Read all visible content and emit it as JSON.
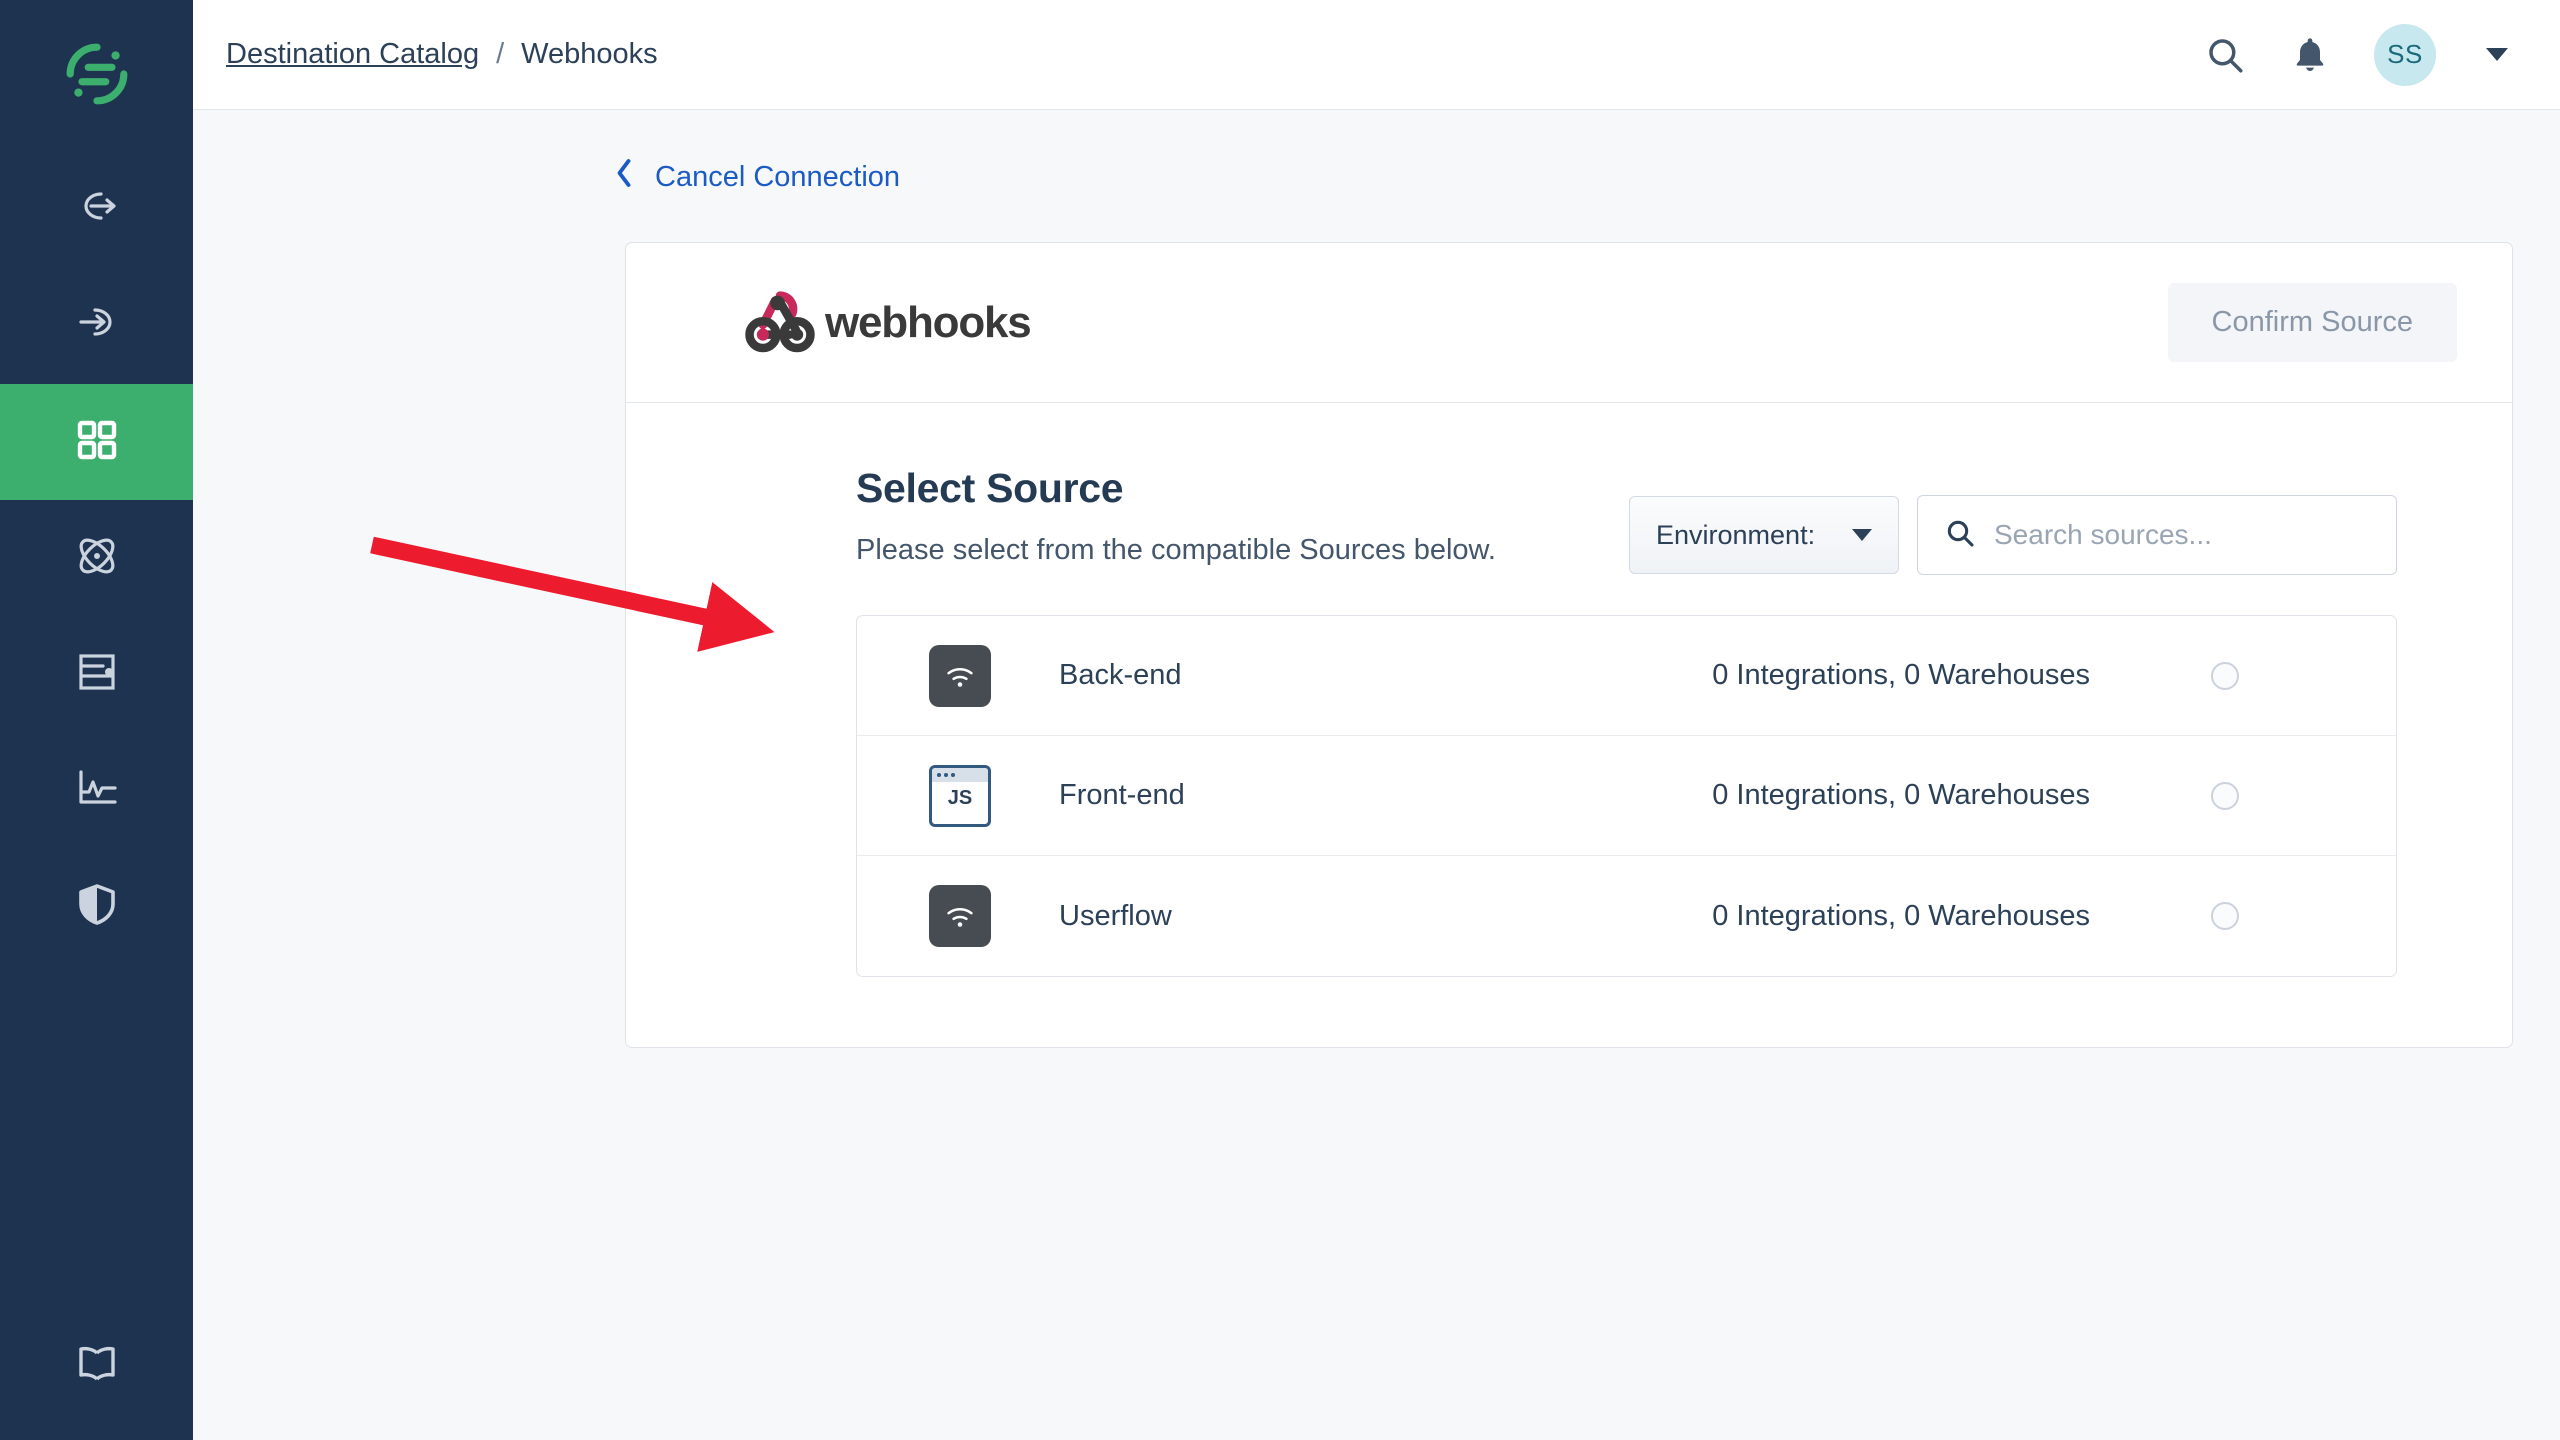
{
  "sidebar": {
    "logo_label": "segment-logo",
    "items": [
      {
        "name": "sources",
        "icon": "arrow-out-circle-icon",
        "active": false
      },
      {
        "name": "destinations",
        "icon": "arrow-in-circle-icon",
        "active": false
      },
      {
        "name": "catalog",
        "icon": "grid-squares-icon",
        "active": true
      },
      {
        "name": "connections",
        "icon": "atom-icon",
        "active": false
      },
      {
        "name": "protocols",
        "icon": "protocols-panel-icon",
        "active": false
      },
      {
        "name": "analytics",
        "icon": "line-chart-icon",
        "active": false
      },
      {
        "name": "privacy",
        "icon": "shield-icon",
        "active": false
      }
    ],
    "bottom_item": {
      "name": "docs",
      "icon": "book-icon"
    }
  },
  "topbar": {
    "breadcrumb": {
      "root_label": "Destination Catalog",
      "separator": "/",
      "current_label": "Webhooks"
    },
    "search_icon": "search-icon",
    "notifications_icon": "bell-icon",
    "avatar_initials": "SS",
    "account_caret": "chevron-down-icon"
  },
  "content": {
    "cancel_link_label": "Cancel Connection",
    "cancel_chevron": "chevron-left-icon"
  },
  "card": {
    "brand_name": "webhooks",
    "brand_logo": "webhooks-logo",
    "confirm_button_label": "Confirm Source",
    "confirm_button_disabled": true
  },
  "select_source": {
    "title": "Select Source",
    "subtitle": "Please select from the compatible Sources below.",
    "environment_label": "Environment:",
    "environment_caret": "chevron-down-icon",
    "search_placeholder": "Search sources...",
    "search_value": "",
    "search_icon": "search-icon",
    "sources": [
      {
        "name": "Back-end",
        "icon": "wifi-signal-icon",
        "icon_type": "dark",
        "meta": "0 Integrations, 0 Warehouses",
        "selected": false
      },
      {
        "name": "Front-end",
        "icon": "js-browser-icon",
        "icon_type": "browser",
        "meta": "0 Integrations, 0 Warehouses",
        "selected": false
      },
      {
        "name": "Userflow",
        "icon": "wifi-signal-icon",
        "icon_type": "dark",
        "meta": "0 Integrations, 0 Warehouses",
        "selected": false
      }
    ]
  },
  "annotation": {
    "type": "red-arrow",
    "color": "#ED1B2E",
    "points_to": "Back-end source row icon"
  },
  "colors": {
    "sidebar_bg": "#1E3350",
    "accent_green": "#3CAF6E",
    "link_blue": "#1A5BC4",
    "text_dark": "#2C4058",
    "page_bg": "#F7F8FA",
    "webhooks_pink": "#C8295A",
    "avatar_bg": "#C6E8EE"
  }
}
